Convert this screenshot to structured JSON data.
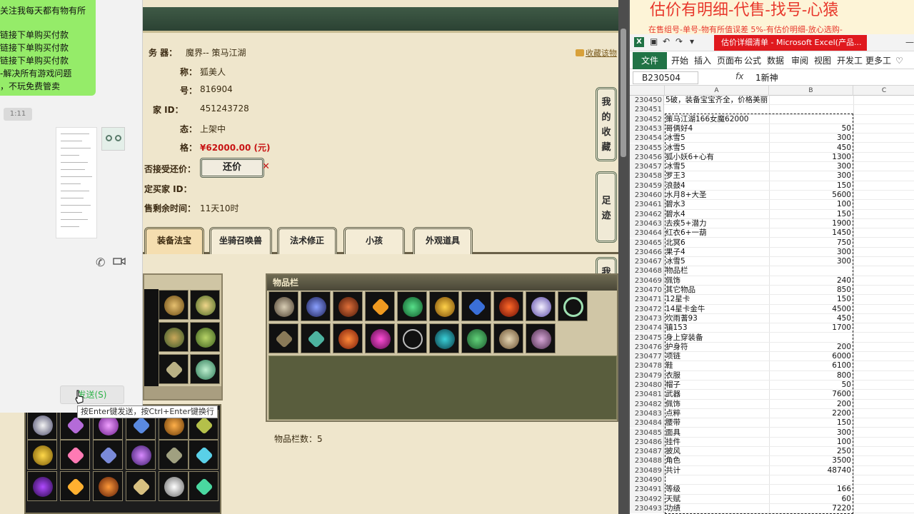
{
  "game": {
    "server_label": "务 器：",
    "server_value": "魔界-- 策马江湖",
    "fav_link": "收藏该物",
    "info_rows": [
      {
        "label": "称：",
        "value": "狐美人"
      },
      {
        "label": "号：",
        "value": "816904"
      },
      {
        "label": "家 ID：",
        "value": "451243728"
      },
      {
        "label": "态：",
        "value": "上架中"
      },
      {
        "label": "格：",
        "value": "¥62000.00 (元)"
      },
      {
        "label": "否接受还价：",
        "value": ""
      },
      {
        "label": "定买家 ID：",
        "value": ""
      },
      {
        "label": "售剩余时间：",
        "value": "11天10时"
      }
    ],
    "counter_offer_button": "还价",
    "side_tabs": [
      "我的收藏",
      "足迹",
      "我的还价"
    ],
    "tabs": [
      "装备法宝",
      "坐骑召唤兽",
      "法术修正",
      "小孩",
      "外观道具"
    ],
    "goods_panel_title": "物品栏",
    "goods_count_label": "物品栏数：5"
  },
  "chat": {
    "message_lines": [
      "关注我每天都有物有所",
      "",
      "链接下单购买付款",
      "链接下单购买付款",
      "链接下单购买付款",
      "-解决所有游戏问题",
      "，不玩免费管卖"
    ],
    "timestamp": "1:11",
    "send_button": "发送(S)",
    "send_tip": "按Enter键发送，按Ctrl+Enter键换行"
  },
  "excel": {
    "banner_big": "估价有明细-代售-找号-心猿",
    "banner_small": "在售组号-单号-物有所值误差 5%-有估价明细-放心选购-",
    "doc_title": "估价详细清单 - Microsoft Excel(产品...",
    "ribbon_file": "文件",
    "ribbon_tabs": [
      "开始",
      "插入",
      "页面布",
      "公式",
      "数据",
      "审阅",
      "视图",
      "开发工",
      "更多工"
    ],
    "name_box": "B230504",
    "fx": "fx",
    "formula_value": "1新神",
    "columns": [
      "A",
      "B",
      "C"
    ],
    "rows": [
      {
        "n": "230450",
        "a": "5破，装备宝宝齐全，价格美丽",
        "b": ""
      },
      {
        "n": "230451",
        "a": "",
        "b": ""
      },
      {
        "n": "230452",
        "a": "策马江湖166女魔62000",
        "b": ""
      },
      {
        "n": "230453",
        "a": "哥俩好4",
        "b": "50"
      },
      {
        "n": "230454",
        "a": "冰雪5",
        "b": "300"
      },
      {
        "n": "230455",
        "a": "冰雪5",
        "b": "450"
      },
      {
        "n": "230456",
        "a": "狐小妖6+心有",
        "b": "1300"
      },
      {
        "n": "230457",
        "a": "冰雪5",
        "b": "300"
      },
      {
        "n": "230458",
        "a": "罗王3",
        "b": "300"
      },
      {
        "n": "230459",
        "a": "浪鼓4",
        "b": "150"
      },
      {
        "n": "230460",
        "a": "水月8+大圣",
        "b": "5600"
      },
      {
        "n": "230461",
        "a": "碧水3",
        "b": "100"
      },
      {
        "n": "230462",
        "a": "碧水4",
        "b": "150"
      },
      {
        "n": "230463",
        "a": "去疾5+潜力",
        "b": "1900"
      },
      {
        "n": "230464",
        "a": "红衣6+一葫",
        "b": "1450"
      },
      {
        "n": "230465",
        "a": "北冥6",
        "b": "750"
      },
      {
        "n": "230466",
        "a": "果子4",
        "b": "300"
      },
      {
        "n": "230467",
        "a": "冰雪5",
        "b": "300"
      },
      {
        "n": "230468",
        "a": "物品栏",
        "b": ""
      },
      {
        "n": "230469",
        "a": "佩饰",
        "b": "240"
      },
      {
        "n": "230470",
        "a": "其它物品",
        "b": "850"
      },
      {
        "n": "230471",
        "a": "12星卡",
        "b": "150"
      },
      {
        "n": "230472",
        "a": "14星卡金牛",
        "b": "4500"
      },
      {
        "n": "230473",
        "a": "坎雨蓍93",
        "b": "450"
      },
      {
        "n": "230474",
        "a": "镇153",
        "b": "1700"
      },
      {
        "n": "230475",
        "a": "身上穿装备",
        "b": ""
      },
      {
        "n": "230476",
        "a": "护身符",
        "b": "200"
      },
      {
        "n": "230477",
        "a": "项链",
        "b": "6000"
      },
      {
        "n": "230478",
        "a": "鞋",
        "b": "6100"
      },
      {
        "n": "230479",
        "a": "衣服",
        "b": "800"
      },
      {
        "n": "230480",
        "a": "帽子",
        "b": "50"
      },
      {
        "n": "230481",
        "a": "武器",
        "b": "7600"
      },
      {
        "n": "230482",
        "a": "佩饰",
        "b": "200"
      },
      {
        "n": "230483",
        "a": "点粹",
        "b": "2200"
      },
      {
        "n": "230484",
        "a": "腰带",
        "b": "150"
      },
      {
        "n": "230485",
        "a": "面具",
        "b": "300"
      },
      {
        "n": "230486",
        "a": "挂件",
        "b": "100"
      },
      {
        "n": "230487",
        "a": "披风",
        "b": "250"
      },
      {
        "n": "230488",
        "a": "角色",
        "b": "3500"
      },
      {
        "n": "230489",
        "a": "共计",
        "b": "48740"
      },
      {
        "n": "230490",
        "a": "",
        "b": ""
      },
      {
        "n": "230491",
        "a": "等级",
        "b": "166"
      },
      {
        "n": "230492",
        "a": "天赋",
        "b": "60"
      },
      {
        "n": "230493",
        "a": "功绩",
        "b": "7220"
      }
    ]
  }
}
